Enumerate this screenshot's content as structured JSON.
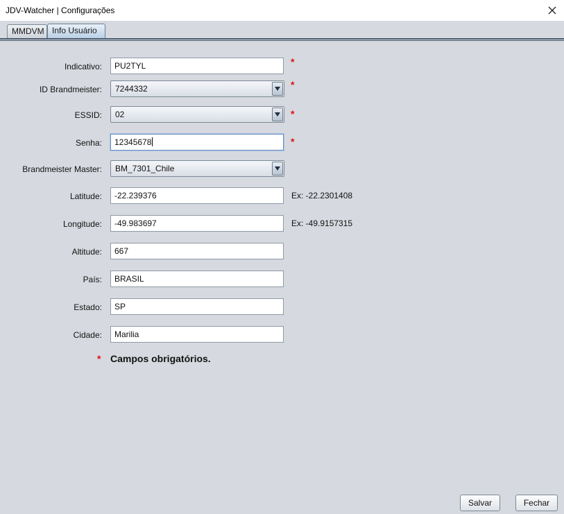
{
  "window": {
    "title": "JDV-Watcher | Configurações",
    "close_icon": "close-icon"
  },
  "tabs": [
    {
      "label": "MMDVM"
    },
    {
      "label": "Info Usuário"
    }
  ],
  "form": {
    "indicativo": {
      "label": "Indicativo:",
      "value": "PU2TYL"
    },
    "id_brandmeister": {
      "label": "ID Brandmeister:",
      "value": "7244332"
    },
    "essid": {
      "label": "ESSID:",
      "value": "02"
    },
    "senha": {
      "label": "Senha:",
      "value": "12345678"
    },
    "brandmeister_master": {
      "label": "Brandmeister Master:",
      "value": "BM_7301_Chile"
    },
    "latitude": {
      "label": "Latitude:",
      "value": "-22.239376",
      "hint": "Ex: -22.2301408"
    },
    "longitude": {
      "label": "Longitude:",
      "value": "-49.983697",
      "hint": "Ex: -49.9157315"
    },
    "altitude": {
      "label": "Altitude:",
      "value": "667"
    },
    "pais": {
      "label": "País:",
      "value": "BRASIL"
    },
    "estado": {
      "label": "Estado:",
      "value": "SP"
    },
    "cidade": {
      "label": "Cidade:",
      "value": "Marilia"
    }
  },
  "required_mark": "*",
  "required_note": "Campos obrigatórios.",
  "buttons": {
    "save": "Salvar",
    "close": "Fechar"
  },
  "colors": {
    "required": "#e01010",
    "background": "#d6d9df"
  }
}
